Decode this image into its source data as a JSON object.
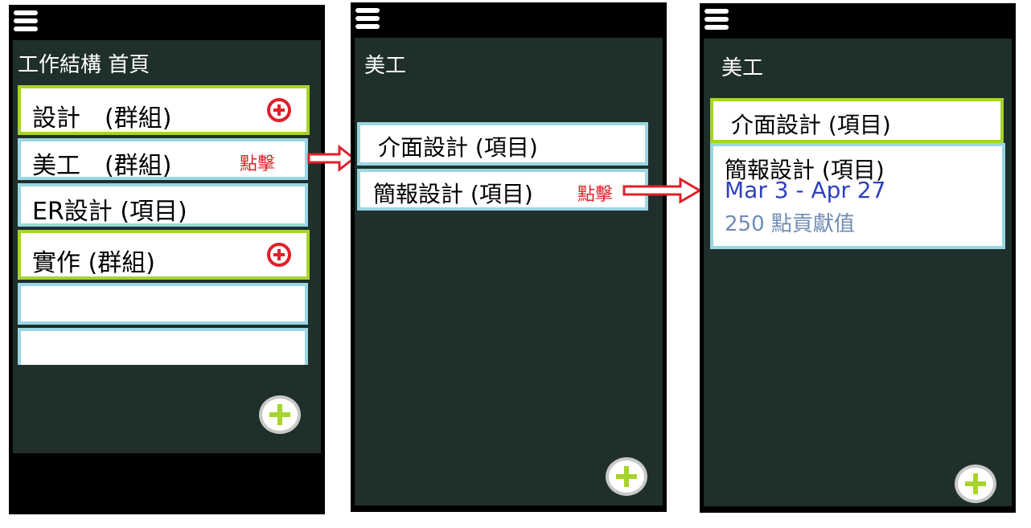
{
  "screens": [
    {
      "title": "工作結構 首頁",
      "items": [
        {
          "label": "設計　(群組)",
          "type": "group"
        },
        {
          "label": "美工　(群組)",
          "type": "group"
        },
        {
          "label": "ER設計 (項目)",
          "type": "item"
        },
        {
          "label": "實作 (群組)",
          "type": "group"
        },
        {
          "label": "",
          "type": "item"
        },
        {
          "label": "",
          "type": "item"
        }
      ],
      "annotation": "點擊"
    },
    {
      "title": "美工",
      "items": [
        {
          "label": "介面設計 (項目)",
          "type": "item"
        },
        {
          "label": "簡報設計 (項目)",
          "type": "item"
        }
      ],
      "annotation": "點擊"
    },
    {
      "title": "美工",
      "items": [
        {
          "label": "介面設計 (項目)",
          "type": "item"
        },
        {
          "label": "簡報設計 (項目)",
          "type": "item",
          "date_range": "Mar 3 - Apr 27",
          "points": "250 點貢獻值"
        }
      ]
    }
  ],
  "icons": {
    "menu": "hamburger-menu-icon",
    "add_group_child": "plus-circle-icon",
    "add_fab": "plus-icon",
    "navigate": "arrow-right-icon"
  },
  "colors": {
    "screen_bg": "#1f2f2b",
    "group_border": "#a6d32c",
    "item_border": "#9ad6e4",
    "accent_red": "#e0202a",
    "fab_plus": "#a6d32c",
    "date_text": "#2f3fbf",
    "points_text": "#6f8bb5"
  }
}
